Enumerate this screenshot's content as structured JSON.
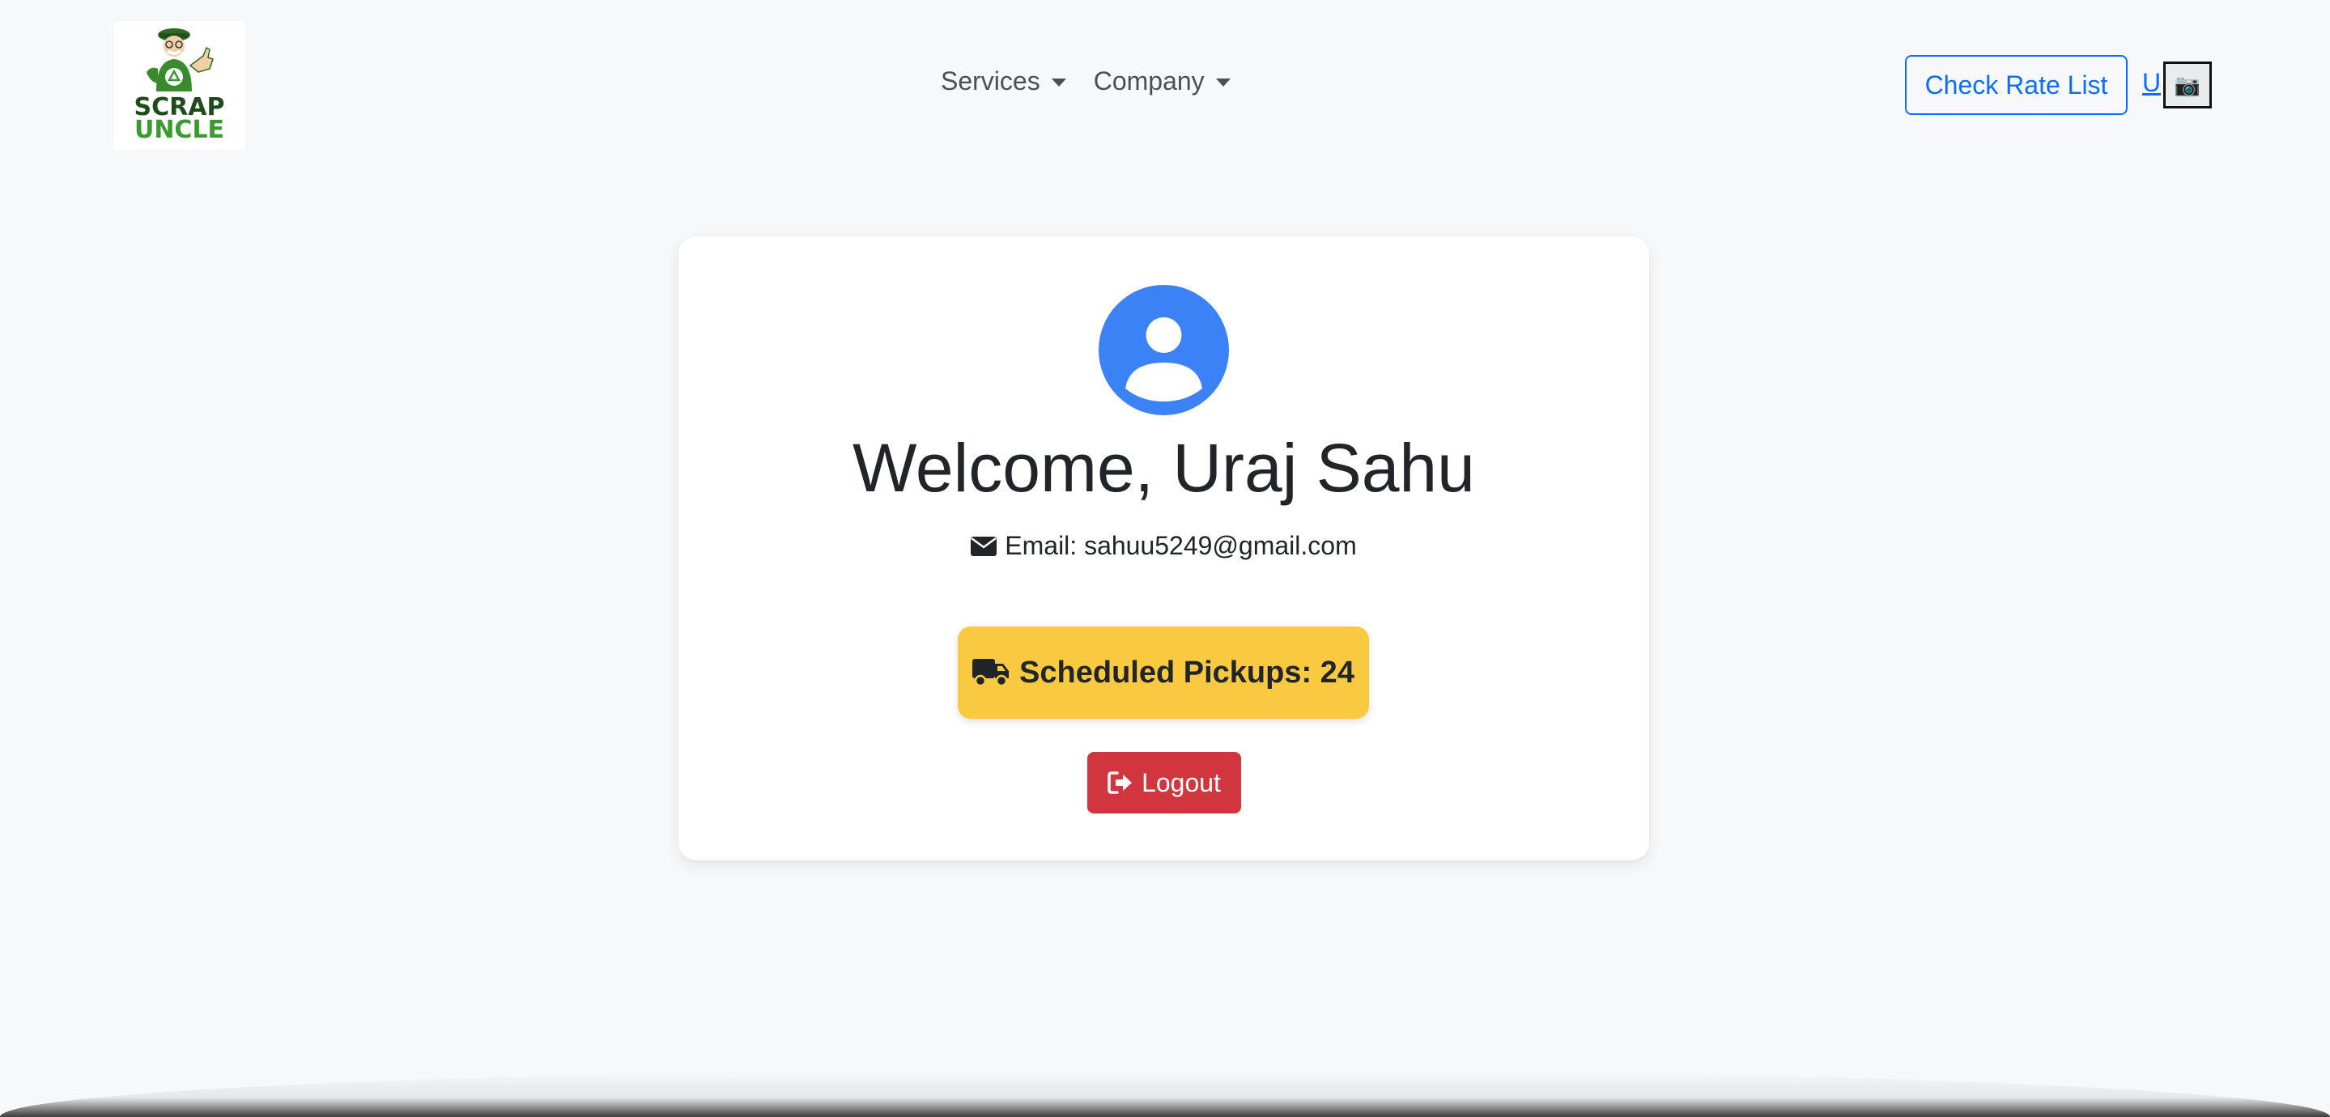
{
  "logo": {
    "line1": "SCRAP",
    "line2": "UNCLE"
  },
  "nav": {
    "services_label": "Services",
    "company_label": "Company",
    "rate_button_label": "Check Rate List",
    "user_initial": "U",
    "camera_icon": "📷"
  },
  "profile": {
    "welcome": "Welcome, Uraj Sahu",
    "email_label": "Email: sahuu5249@gmail.com",
    "pickups_label": "Scheduled Pickups: 24",
    "logout_label": "Logout"
  },
  "colors": {
    "primary": "#0d6efd",
    "avatar": "#3b82f6",
    "pickups_bg": "#f9ca3f",
    "logout_bg": "#d1363f",
    "background": "#f7f8fa"
  }
}
